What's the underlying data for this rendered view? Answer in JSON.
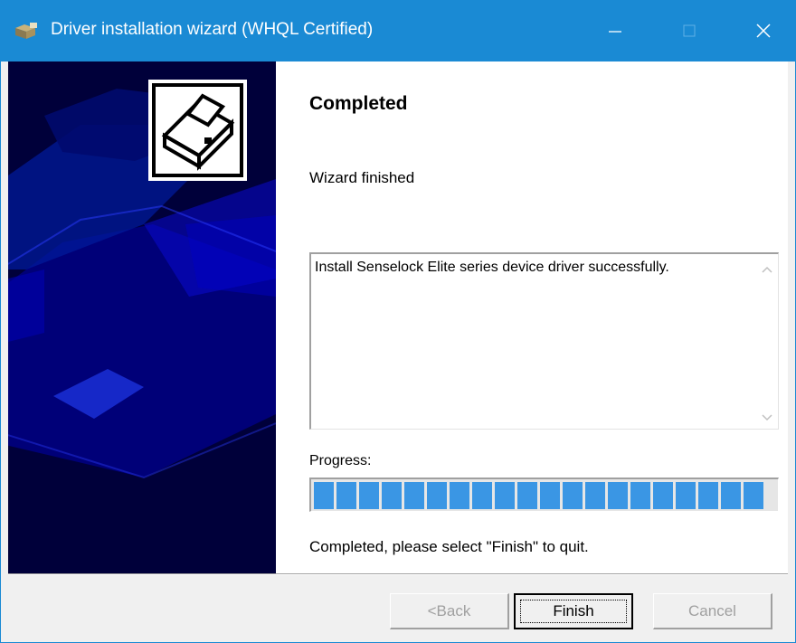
{
  "window": {
    "title": "Driver installation wizard (WHQL Certified)",
    "icon": "driver-app-icon",
    "controls": [
      "minimize-icon",
      "maximize-icon",
      "close-icon"
    ]
  },
  "side_panel": {
    "illustration": "printer-watermark",
    "badge_icon": "printer-icon"
  },
  "main": {
    "heading": "Completed",
    "subheading": "Wizard finished",
    "log_text": "Install Senselock Elite series device driver successfully.",
    "progress_label": "Progress:",
    "progress_fraction": 1.0,
    "status_text": "Completed, please select \"Finish\" to quit."
  },
  "buttons": {
    "back": "<Back",
    "finish": "Finish",
    "cancel": "Cancel"
  },
  "colors": {
    "titlebar": "#1a8ad4",
    "side_panel_bg": "#00003a",
    "progress_fill": "#3a96e4"
  }
}
